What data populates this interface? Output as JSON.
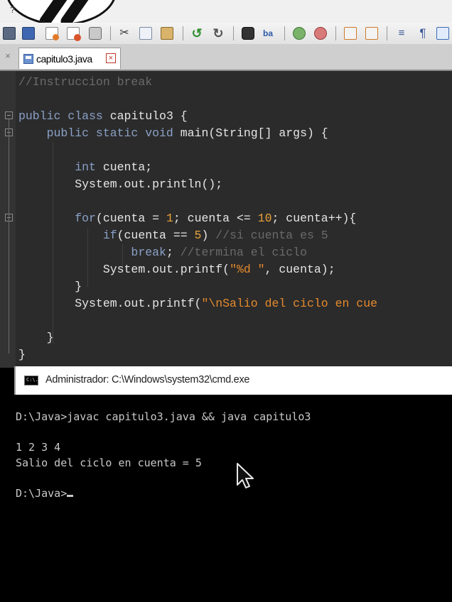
{
  "menubar": {
    "help_label": "?"
  },
  "toolbar": {
    "buttons": [
      "new-file",
      "open-file",
      "save-file",
      "save-all",
      "close-file",
      "print",
      "cut",
      "copy",
      "paste",
      "undo",
      "redo",
      "find",
      "replace",
      "zoom-in",
      "zoom-out",
      "sync-vertical",
      "sync-horizontal",
      "word-wrap",
      "show-all-characters",
      "indent-guide"
    ]
  },
  "tabs": [
    {
      "label": "capitulo3.java",
      "close_glyph": "×"
    }
  ],
  "tabbar": {
    "close_all_glyph": "×"
  },
  "editor": {
    "lines": [
      [
        {
          "t": "//Instruccion break",
          "c": "cm"
        }
      ],
      [],
      [
        {
          "t": "public class ",
          "c": "kw"
        },
        {
          "t": "capitulo3 {",
          "c": "id"
        }
      ],
      [
        {
          "t": "    public static void ",
          "c": "kw"
        },
        {
          "t": "main(String[] args) {",
          "c": "id"
        }
      ],
      [],
      [
        {
          "t": "        int ",
          "c": "kw"
        },
        {
          "t": "cuenta;",
          "c": "id"
        }
      ],
      [
        {
          "t": "        System.out.println();",
          "c": "id"
        }
      ],
      [],
      [
        {
          "t": "        for",
          "c": "kw"
        },
        {
          "t": "(cuenta = ",
          "c": "id"
        },
        {
          "t": "1",
          "c": "nm"
        },
        {
          "t": "; cuenta <= ",
          "c": "id"
        },
        {
          "t": "10",
          "c": "nm"
        },
        {
          "t": "; cuenta++){",
          "c": "id"
        }
      ],
      [
        {
          "t": "            if",
          "c": "kw"
        },
        {
          "t": "(cuenta == ",
          "c": "id"
        },
        {
          "t": "5",
          "c": "nm"
        },
        {
          "t": ") ",
          "c": "id"
        },
        {
          "t": "//si cuenta es 5",
          "c": "cm"
        }
      ],
      [
        {
          "t": "                break",
          "c": "kw"
        },
        {
          "t": "; ",
          "c": "id"
        },
        {
          "t": "//termina el ciclo",
          "c": "cm"
        }
      ],
      [
        {
          "t": "            System.out.printf(",
          "c": "id"
        },
        {
          "t": "\"%d \"",
          "c": "st"
        },
        {
          "t": ", cuenta);",
          "c": "id"
        }
      ],
      [
        {
          "t": "        }",
          "c": "id"
        }
      ],
      [
        {
          "t": "        System.out.printf(",
          "c": "id"
        },
        {
          "t": "\"\\nSalio del ciclo en cue",
          "c": "st"
        }
      ],
      [],
      [
        {
          "t": "    }",
          "c": "id"
        }
      ],
      [
        {
          "t": "}",
          "c": "id"
        }
      ]
    ]
  },
  "cmd": {
    "title": "Administrador: C:\\Windows\\system32\\cmd.exe",
    "icon_text": "C:\\.",
    "lines": [
      "D:\\Java>javac capitulo3.java && java capitulo3",
      "",
      "1 2 3 4",
      "Salio del ciclo en cuenta = 5",
      "",
      "D:\\Java>"
    ]
  },
  "colors": {
    "editor_bg": "#2b2b2b",
    "keyword": "#8aa0c7",
    "comment": "#6a6a6a",
    "number": "#e9a33a",
    "string": "#e58a2c",
    "console_text": "#c8c8c8"
  }
}
